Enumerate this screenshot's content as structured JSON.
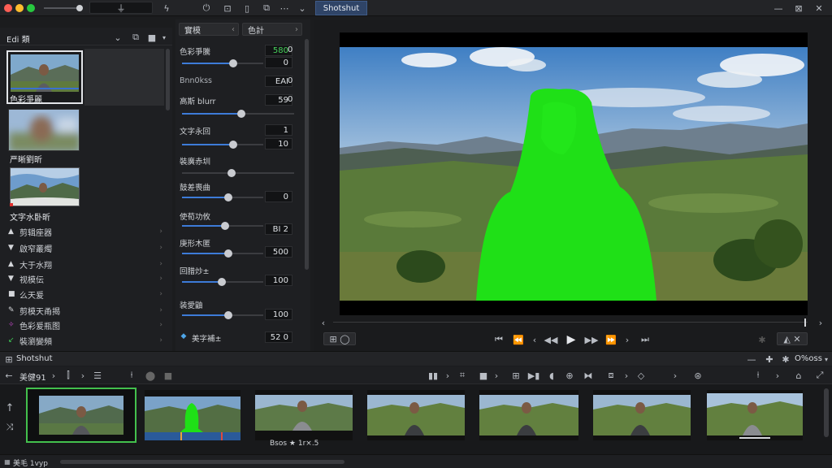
{
  "topbar": {
    "search_icon": "waveform-icon",
    "active_tab": "Shotshut"
  },
  "left": {
    "header_label": "Edi 類",
    "clips": [
      {
        "label": "色彩爭麗"
      },
      {
        "label": "严晰劉昕"
      },
      {
        "label": "文字水卧昕"
      }
    ],
    "effects": [
      {
        "label": "剪辑座器"
      },
      {
        "label": "啟窄叢燭"
      },
      {
        "label": "大于水翔"
      },
      {
        "label": "视模伝"
      },
      {
        "label": "么天爰"
      },
      {
        "label": "剪模天甬揭"
      },
      {
        "label": "色彩爰瓶图"
      },
      {
        "label": "裝瀏變頻"
      }
    ]
  },
  "props": {
    "btn_left": "實模",
    "btn_right": "色計",
    "rows": [
      {
        "label": "色彩爭騰",
        "value": "580",
        "value2": "0",
        "value3": "0"
      },
      {
        "label": "Bnn0kss",
        "value": "EAI",
        "value2": "0"
      },
      {
        "label": "高斯 blurr",
        "value": "59",
        "value2": "0"
      },
      {
        "label": "文字永回",
        "value": "1",
        "value2": "10"
      },
      {
        "label": "裝廣赤圳",
        "value": ""
      },
      {
        "label": "鼓差喪曲",
        "value": "0"
      },
      {
        "label": "使荀功攸",
        "value": "BI",
        "value2": "2"
      },
      {
        "label": "庚形木匿",
        "value": "500"
      },
      {
        "label": "回腊炒±",
        "value": "100"
      },
      {
        "label": "装愛鼬",
        "value": "100"
      },
      {
        "label": "美字補±",
        "value": "52",
        "value2": "0"
      }
    ]
  },
  "timeline": {
    "title": "Shotshut",
    "right_label": "O%oss",
    "tool_label": "美健91",
    "clip_caption": "Bsos ★ 1r×.5",
    "status_label": "美毛 1vyp"
  }
}
